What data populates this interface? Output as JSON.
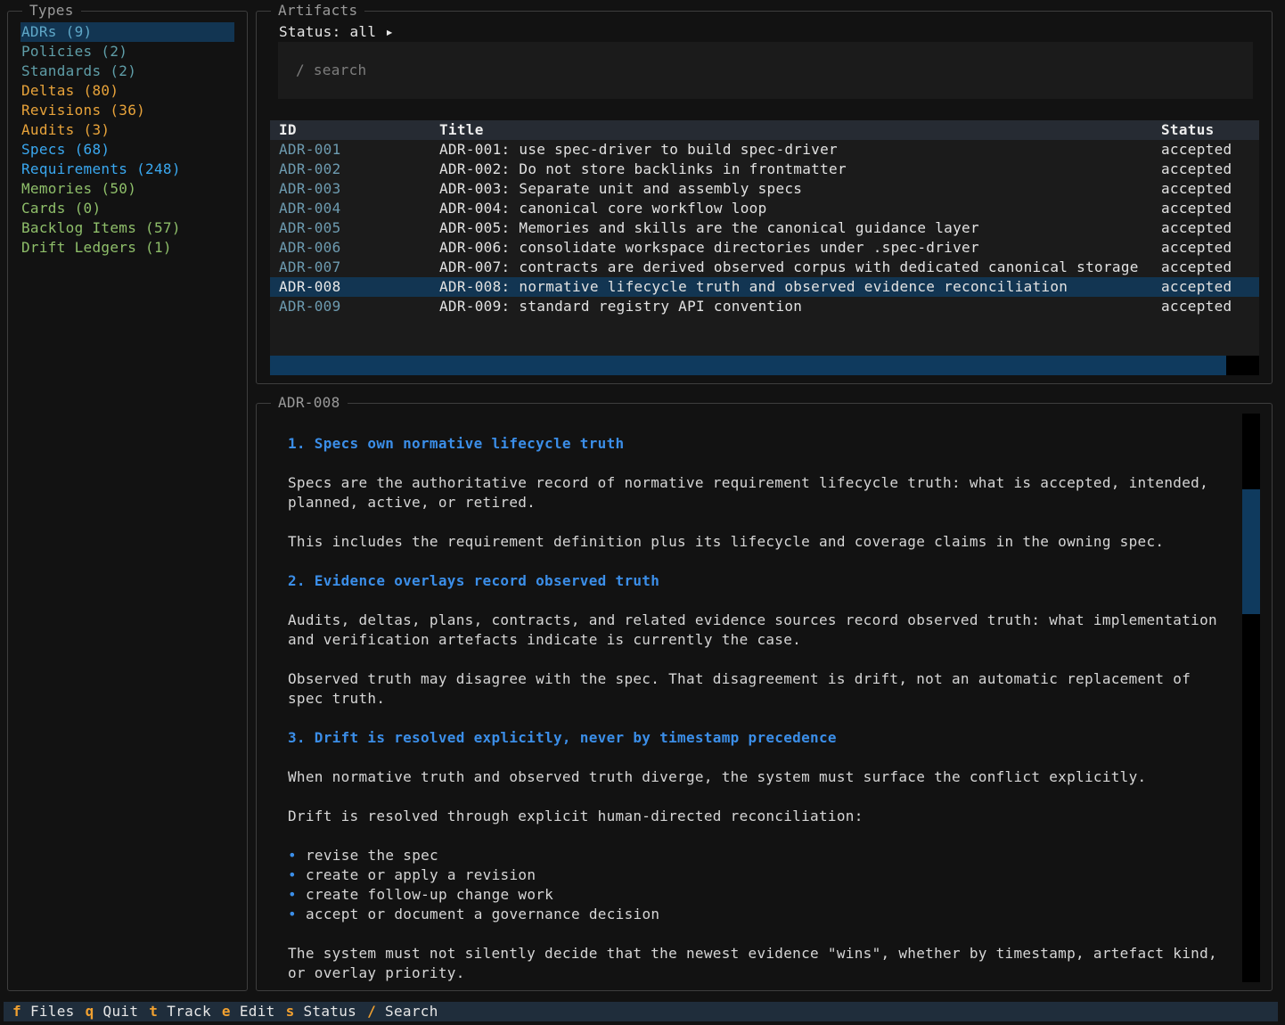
{
  "types": {
    "title": "Types",
    "items": [
      {
        "label": "ADRs (9)",
        "color": "#5fa8c8",
        "active": true
      },
      {
        "label": "Policies (2)",
        "color": "#5f9ea8"
      },
      {
        "label": "Standards (2)",
        "color": "#5f9ea8"
      },
      {
        "label": "Deltas (80)",
        "color": "#e8a33a"
      },
      {
        "label": "Revisions (36)",
        "color": "#e8a33a"
      },
      {
        "label": "Audits (3)",
        "color": "#e8a33a"
      },
      {
        "label": "Specs (68)",
        "color": "#3aa8f0"
      },
      {
        "label": "Requirements (248)",
        "color": "#3aa8f0"
      },
      {
        "label": "Memories (50)",
        "color": "#8fbf6a"
      },
      {
        "label": "Cards (0)",
        "color": "#8fbf6a"
      },
      {
        "label": "Backlog Items (57)",
        "color": "#8fbf6a"
      },
      {
        "label": "Drift Ledgers (1)",
        "color": "#8fbf6a"
      }
    ]
  },
  "artifacts": {
    "title": "Artifacts",
    "status_filter": "Status: all ▸",
    "search_placeholder": "/ search",
    "columns": {
      "id": "ID",
      "title": "Title",
      "status": "Status"
    },
    "rows": [
      {
        "id": "ADR-001",
        "title": "ADR-001: use spec-driver to build spec-driver",
        "status": "accepted"
      },
      {
        "id": "ADR-002",
        "title": "ADR-002: Do not store backlinks in frontmatter",
        "status": "accepted"
      },
      {
        "id": "ADR-003",
        "title": "ADR-003: Separate unit and assembly specs",
        "status": "accepted"
      },
      {
        "id": "ADR-004",
        "title": "ADR-004: canonical core workflow loop",
        "status": "accepted"
      },
      {
        "id": "ADR-005",
        "title": "ADR-005: Memories and skills are the canonical guidance layer",
        "status": "accepted"
      },
      {
        "id": "ADR-006",
        "title": "ADR-006: consolidate workspace directories under .spec-driver",
        "status": "accepted"
      },
      {
        "id": "ADR-007",
        "title": "ADR-007: contracts are derived observed corpus with dedicated canonical storage",
        "status": "accepted"
      },
      {
        "id": "ADR-008",
        "title": "ADR-008: normative lifecycle truth and observed evidence reconciliation",
        "status": "accepted",
        "selected": true
      },
      {
        "id": "ADR-009",
        "title": "ADR-009: standard registry API convention",
        "status": "accepted"
      }
    ],
    "hscroll_fraction": 0.967
  },
  "detail": {
    "title": "ADR-008",
    "scroll_fraction": 0.22,
    "h1": "1. Specs own normative lifecycle truth",
    "p1a": "Specs are the authoritative record of normative requirement lifecycle truth: what is accepted, intended,",
    "p1b": "planned, active, or retired.",
    "p2": "This includes the requirement definition plus its lifecycle and coverage claims in the owning spec.",
    "h2": "2. Evidence overlays record observed truth",
    "p3a": "Audits, deltas, plans, contracts, and related evidence sources record observed truth: what implementation",
    "p3b": "and verification artefacts indicate is currently the case.",
    "p4a": "Observed truth may disagree with the spec. That disagreement is drift, not an automatic replacement of",
    "p4b": "spec truth.",
    "h3": "3. Drift is resolved explicitly, never by timestamp precedence",
    "p5": "When normative truth and observed truth diverge, the system must surface the conflict explicitly.",
    "p6": "Drift is resolved through explicit human-directed reconciliation:",
    "bullets": [
      "revise the spec",
      "create or apply a revision",
      "create follow-up change work",
      "accept or document a governance decision"
    ],
    "bullet_glyph": "•",
    "p7a": "The system must not silently decide that the newest evidence \"wins\", whether by timestamp, artefact kind,",
    "p7b": "or overlay priority."
  },
  "footer": {
    "items": [
      {
        "key": "f",
        "label": "Files"
      },
      {
        "key": "q",
        "label": "Quit"
      },
      {
        "key": "t",
        "label": "Track"
      },
      {
        "key": "e",
        "label": "Edit"
      },
      {
        "key": "s",
        "label": "Status"
      },
      {
        "key": "/",
        "label": "Search"
      }
    ]
  }
}
